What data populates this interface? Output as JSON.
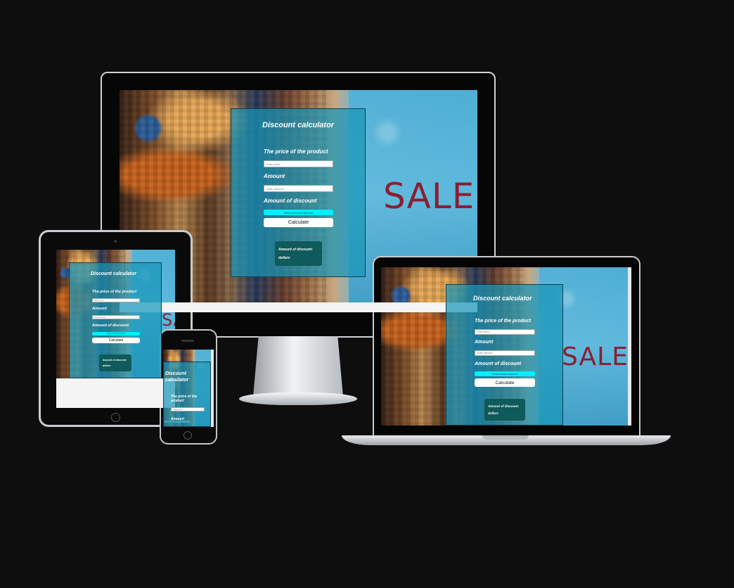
{
  "app": {
    "title": "Discount calculator",
    "price_label": "The price of the product",
    "price_placeholder": "Enter price...",
    "amount_label": "Amount",
    "amount_placeholder": "Enter amount...",
    "discount_label": "Amount of discount",
    "discount_select": "Select amount discount",
    "calculate_label": "Calculate",
    "result_label": "Amount of discount:",
    "result_unit": "dollars"
  },
  "background": {
    "sale_text": "SALE"
  },
  "colors": {
    "panel": "#1896b9",
    "select": "#00f0ff",
    "result_box": "#0f5a5a",
    "page_background": "#0e0e0f",
    "sale": "#8a1f33"
  }
}
